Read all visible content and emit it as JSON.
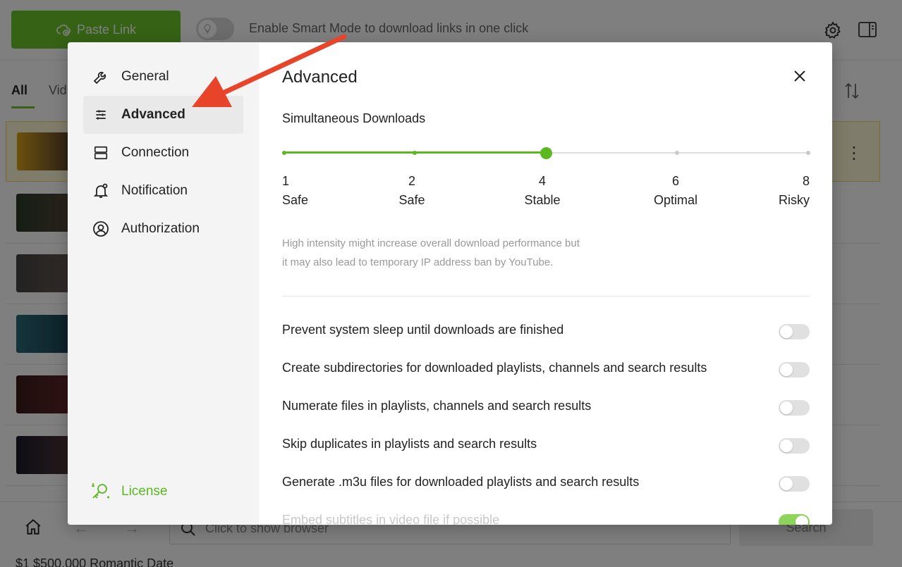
{
  "topbar": {
    "paste_label": "Paste Link",
    "smart_mode_text": "Enable Smart Mode to download links in one click"
  },
  "tabs": {
    "all": "All",
    "video": "Vid"
  },
  "bottombar": {
    "browser_placeholder": "Click to show browser",
    "search_label": "Search",
    "footer_text": "$1    $500,000 Romantic Date"
  },
  "settings": {
    "nav": [
      {
        "label": "General",
        "icon": "wrench-icon"
      },
      {
        "label": "Advanced",
        "icon": "sliders-icon"
      },
      {
        "label": "Connection",
        "icon": "server-icon"
      },
      {
        "label": "Notification",
        "icon": "bell-icon"
      },
      {
        "label": "Authorization",
        "icon": "user-circle-icon"
      }
    ],
    "license_label": "License",
    "title": "Advanced",
    "simultaneous_label": "Simultaneous Downloads",
    "slider": {
      "steps": [
        {
          "value": "1",
          "label": "Safe"
        },
        {
          "value": "2",
          "label": "Safe"
        },
        {
          "value": "4",
          "label": "Stable"
        },
        {
          "value": "6",
          "label": "Optimal"
        },
        {
          "value": "8",
          "label": "Risky"
        }
      ],
      "selected_value": "4"
    },
    "hint_line1": "High intensity might increase overall download performance but",
    "hint_line2": "it may also lead to temporary IP address ban by YouTube.",
    "options": [
      {
        "label": "Prevent system sleep until downloads are finished",
        "enabled": false
      },
      {
        "label": "Create subdirectories for downloaded playlists, channels and search results",
        "enabled": false
      },
      {
        "label": "Numerate files in playlists, channels and search results",
        "enabled": false
      },
      {
        "label": "Skip duplicates in playlists and search results",
        "enabled": false
      },
      {
        "label": "Generate .m3u files for downloaded playlists and search results",
        "enabled": false
      },
      {
        "label": "Embed subtitles in video file if possible",
        "enabled": true
      }
    ]
  },
  "colors": {
    "accent": "#5cb81f",
    "annotation_arrow": "#e8442a"
  }
}
